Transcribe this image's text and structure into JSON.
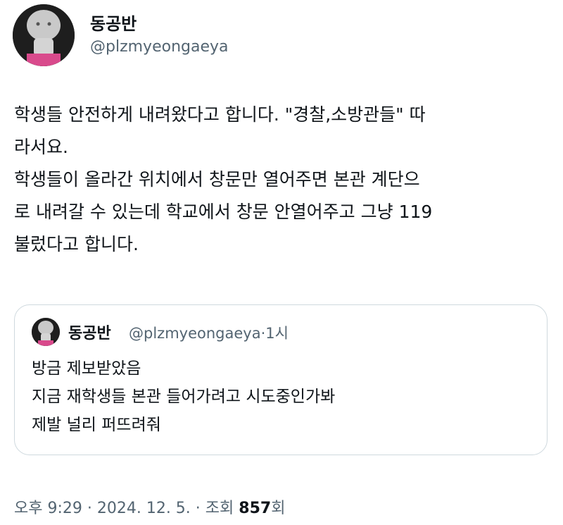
{
  "author": {
    "display_name": "동공반",
    "handle": "@plzmyeongaeya"
  },
  "tweet": {
    "lines": [
      "학생들 안전하게 내려왔다고 합니다. \"경찰,소방관들\" 따",
      "라서요.",
      "학생들이 올라간 위치에서 창문만 열어주면 본관 계단으",
      "로 내려갈 수 있는데 학교에서 창문 안열어주고 그냥 119",
      "불렀다고 합니다."
    ]
  },
  "quote": {
    "display_name": "동공반",
    "handle": "@plzmyeongaeya",
    "time": "·1시",
    "lines": [
      "방금 제보받았음",
      "지금 재학생들 본관 들어가려고 시도중인가봐",
      "제발 널리 퍼뜨려줘"
    ]
  },
  "meta": {
    "timestamp": "오후 9:29 · 2024. 12. 5. · 조회 ",
    "views": "857",
    "views_suffix": "회"
  },
  "icons": {
    "avatar": "avatar-icon"
  }
}
